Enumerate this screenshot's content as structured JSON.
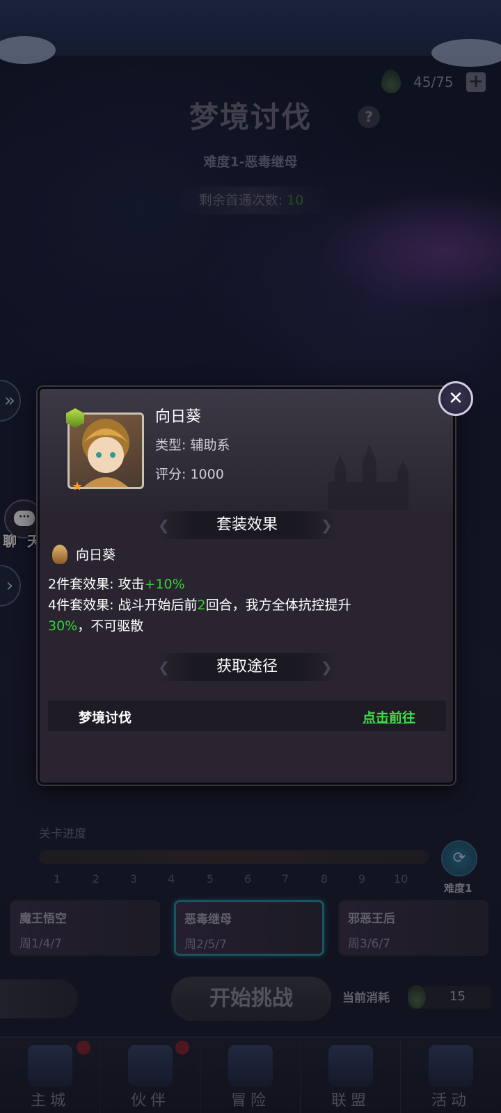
{
  "resource": {
    "stamina": "45/75"
  },
  "header": {
    "title": "梦境讨伐",
    "difficulty_title": "难度1-恶毒继母",
    "remain_label": "剩余首通次数:",
    "remain_count": "10"
  },
  "side": {
    "chat_label": "聊 天"
  },
  "modal": {
    "hero_name": "向日葵",
    "type_line": "类型: 辅助系",
    "score_line": "评分: 1000",
    "set_section_title": "套装效果",
    "set_name": "向日葵",
    "effect2_prefix": "2件套效果: 攻击",
    "effect2_value": "+10%",
    "effect4_prefix": "4件套效果: 战斗开始后前",
    "effect4_rounds": "2",
    "effect4_mid": "回合，我方全体抗控提升",
    "effect4_value": "30%",
    "effect4_suffix": "，不可驱散",
    "source_section_title": "获取途径",
    "source_name": "梦境讨伐",
    "source_link": "点击前往"
  },
  "progress": {
    "label": "关卡进度",
    "nodes": [
      "1",
      "2",
      "3",
      "4",
      "5",
      "6",
      "7",
      "8",
      "9",
      "10"
    ],
    "difficulty_label": "难度1"
  },
  "bosses": [
    {
      "name": "魔王悟空",
      "days": "周1/4/7"
    },
    {
      "name": "恶毒继母",
      "days": "周2/5/7",
      "active": true
    },
    {
      "name": "邪恶王后",
      "days": "周3/6/7"
    }
  ],
  "actions": {
    "start_label": "开始挑战",
    "cost_label": "当前消耗",
    "cost_value": "15"
  },
  "nav": {
    "items": [
      {
        "label": "主城",
        "badge": true
      },
      {
        "label": "伙伴",
        "badge": true
      },
      {
        "label": "冒险",
        "badge": false
      },
      {
        "label": "联盟",
        "badge": false
      },
      {
        "label": "活动",
        "badge": false
      }
    ]
  },
  "colors": {
    "highlight_green": "#38d23a",
    "link_green": "#3be04a",
    "active_border": "#2a8fa0"
  }
}
